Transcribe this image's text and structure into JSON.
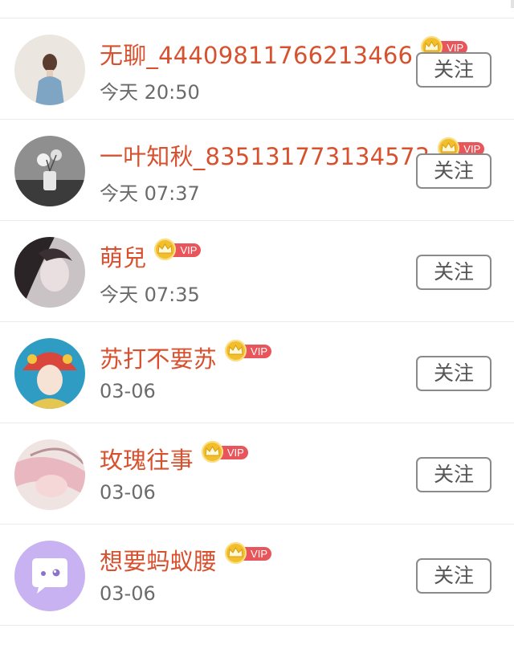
{
  "follow_label": "关注",
  "vip_label": "VIP",
  "colors": {
    "name": "#d8512f",
    "vip_badge": "#e8555a",
    "crown": "#f2be2b",
    "time": "#6b6b6b"
  },
  "users": [
    {
      "name": "无聊_44409811766213466",
      "time": "今天 20:50",
      "vip": true,
      "avatar": "girl-blue-jacket-avatar"
    },
    {
      "name": "一叶知秋_835131773134573",
      "time": "今天 07:37",
      "vip": true,
      "avatar": "flower-vase-avatar"
    },
    {
      "name": "萌兒",
      "time": "今天 07:35",
      "vip": true,
      "avatar": "woman-portrait-avatar"
    },
    {
      "name": "苏打不要苏",
      "time": "03-06",
      "vip": true,
      "avatar": "opera-girl-avatar"
    },
    {
      "name": "玫瑰往事",
      "time": "03-06",
      "vip": true,
      "avatar": "pink-hair-avatar"
    },
    {
      "name": "想要蚂蚁腰",
      "time": "03-06",
      "vip": true,
      "avatar": "chat-bubble-avatar"
    }
  ]
}
